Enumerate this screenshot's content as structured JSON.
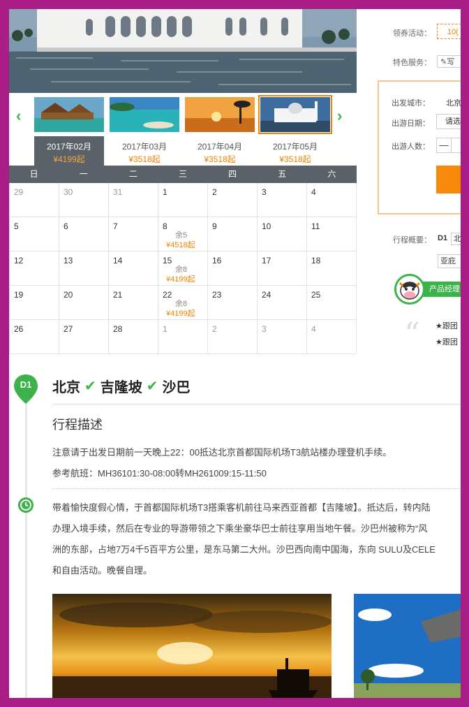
{
  "calendar": {
    "months": [
      {
        "label": "2017年02月",
        "price": "¥4199起",
        "active": true
      },
      {
        "label": "2017年03月",
        "price": "¥3518起",
        "active": false
      },
      {
        "label": "2017年04月",
        "price": "¥3518起",
        "active": false
      },
      {
        "label": "2017年05月",
        "price": "¥3518起",
        "active": false
      }
    ],
    "weekdays": [
      "日",
      "一",
      "二",
      "三",
      "四",
      "五",
      "六"
    ],
    "weeks": [
      [
        {
          "d": "29",
          "dim": true
        },
        {
          "d": "30",
          "dim": true
        },
        {
          "d": "31",
          "dim": true
        },
        {
          "d": "1"
        },
        {
          "d": "2"
        },
        {
          "d": "3"
        },
        {
          "d": "4"
        }
      ],
      [
        {
          "d": "5"
        },
        {
          "d": "6"
        },
        {
          "d": "7"
        },
        {
          "d": "8",
          "rem": "余5",
          "price": "¥4518起"
        },
        {
          "d": "9"
        },
        {
          "d": "10"
        },
        {
          "d": "11"
        }
      ],
      [
        {
          "d": "12"
        },
        {
          "d": "13"
        },
        {
          "d": "14"
        },
        {
          "d": "15",
          "rem": "余8",
          "price": "¥4199起"
        },
        {
          "d": "16"
        },
        {
          "d": "17"
        },
        {
          "d": "18"
        }
      ],
      [
        {
          "d": "19"
        },
        {
          "d": "20"
        },
        {
          "d": "21"
        },
        {
          "d": "22",
          "rem": "余8",
          "price": "¥4199起"
        },
        {
          "d": "23"
        },
        {
          "d": "24"
        },
        {
          "d": "25"
        }
      ],
      [
        {
          "d": "26"
        },
        {
          "d": "27"
        },
        {
          "d": "28"
        },
        {
          "d": "1",
          "dim": true
        },
        {
          "d": "2",
          "dim": true
        },
        {
          "d": "3",
          "dim": true
        },
        {
          "d": "4",
          "dim": true
        }
      ]
    ],
    "prev_icon": "‹",
    "next_icon": "›"
  },
  "sidebar": {
    "coupon_label": "领券活动：",
    "coupon_value": "10(",
    "service_label": "特色服务：",
    "service_value": "写",
    "booking": {
      "city_label": "出发城市：",
      "city_value": "北京",
      "date_label": "出游日期：",
      "date_value": "请选",
      "people_label": "出游人数：",
      "minus": "—"
    },
    "trip_summary_label": "行程概要：",
    "trip_d1": "D1",
    "trip_tag1": "北",
    "trip_tag2": "亚庇",
    "manager_label": "产品经理",
    "notes": [
      "★跟团",
      "★跟团"
    ]
  },
  "itinerary": {
    "day": "D1",
    "route": [
      "北京",
      "吉隆坡",
      "沙巴"
    ],
    "check_icon": "✔",
    "desc_title": "行程描述",
    "notice": "注意请于出发日期前一天晚上22：00抵达北京首都国际机场T3航站楼办理登机手续。",
    "flight": "参考航班：MH36101:30-08:00转MH261009:15-11:50",
    "paragraph": [
      "带着愉快度假心情，于首都国际机场T3搭乘客机前往马来西亚首都【吉隆坡】。抵达后，转内陆",
      "办理入境手续，然后在专业的导游带领之下乘坐豪华巴士前往享用当地午餐。沙巴州被称为“风",
      "洲的东部，占地7万4千5百平方公里，是东马第二大州。沙巴西向南中国海，东向 SULU及CELE",
      "和自由活动。晚餐自理。"
    ]
  },
  "colors": {
    "accent": "#3cb34a",
    "orange": "#f08300",
    "border": "#a81d86",
    "header": "#5a6168"
  }
}
